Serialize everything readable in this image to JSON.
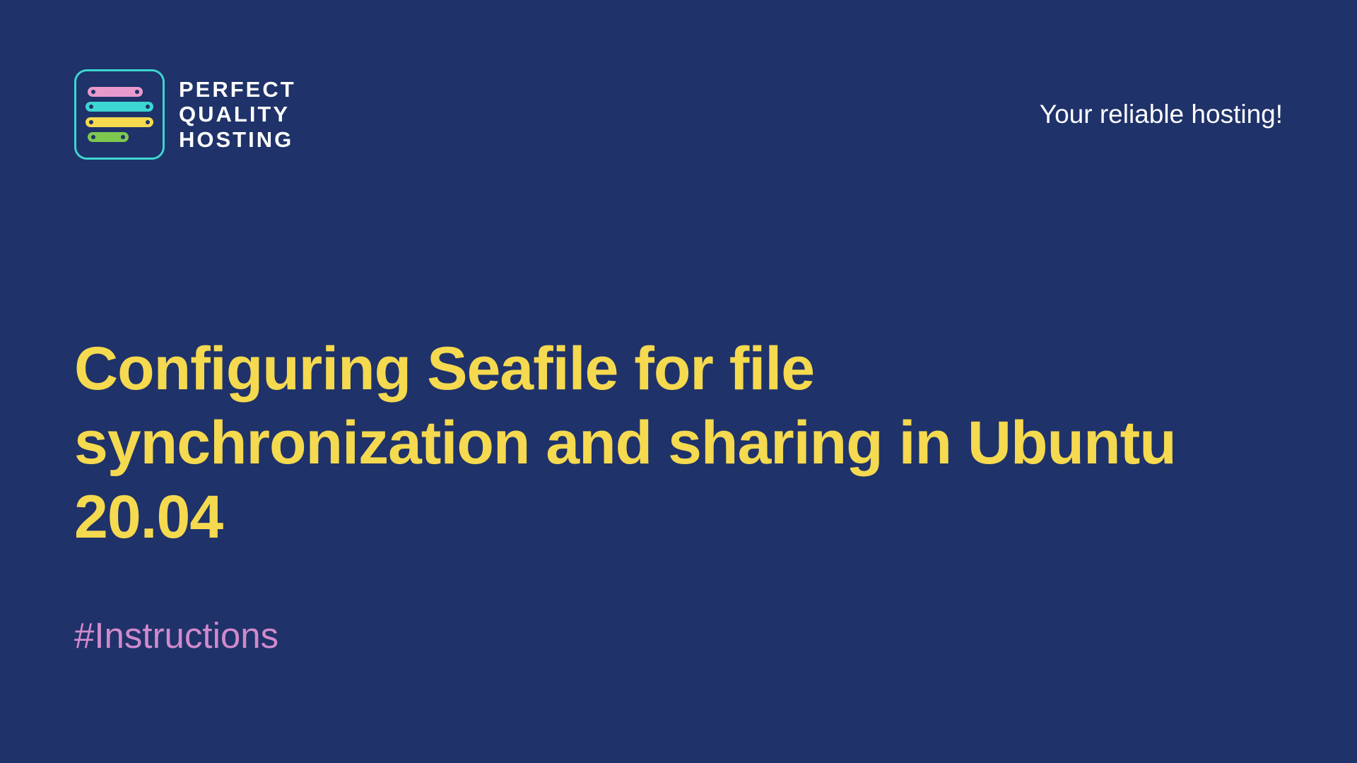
{
  "logo": {
    "line1": "PERFECT",
    "line2": "QUALITY",
    "line3": "HOSTING"
  },
  "tagline": "Your reliable hosting!",
  "title": "Configuring Seafile for file synchronization and sharing in Ubuntu 20.04",
  "hashtag": "#Instructions"
}
